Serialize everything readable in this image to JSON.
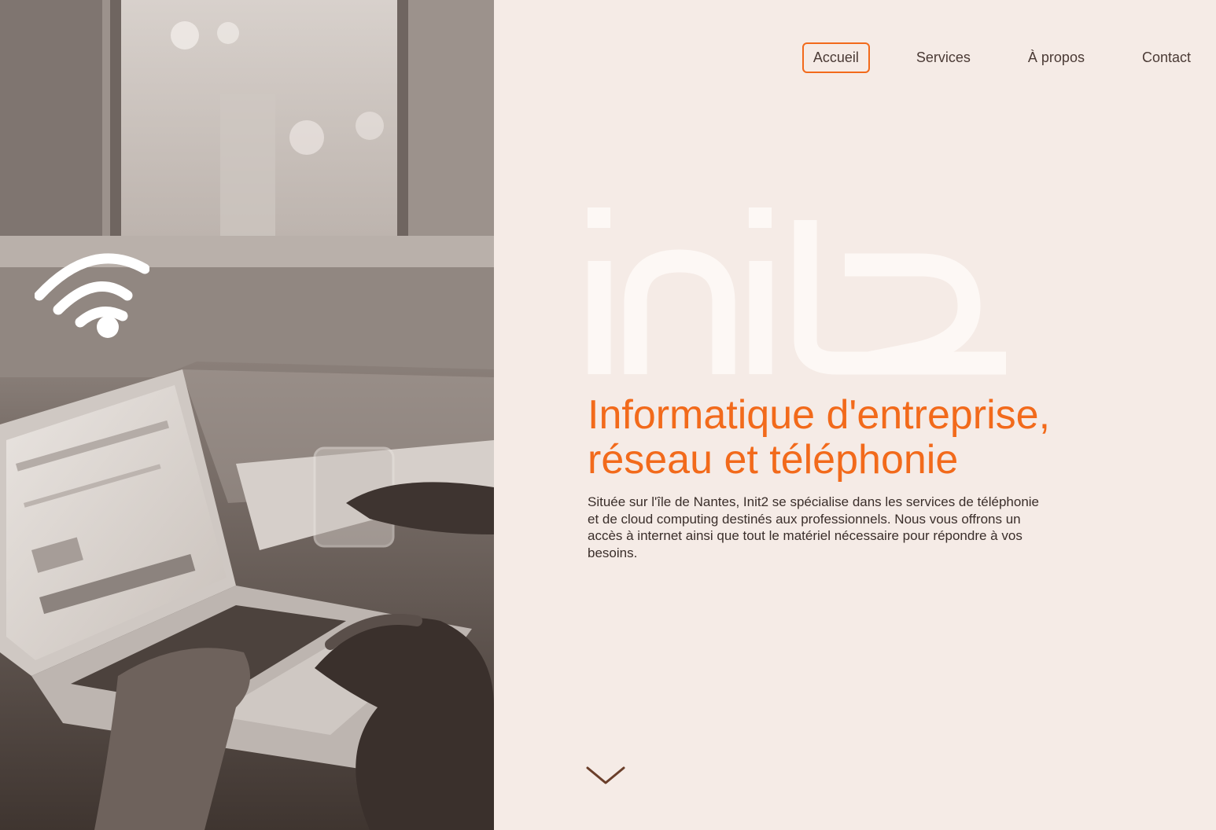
{
  "nav": {
    "items": [
      {
        "label": "Accueil",
        "active": true
      },
      {
        "label": "Services",
        "active": false
      },
      {
        "label": "À propos",
        "active": false
      },
      {
        "label": "Contact",
        "active": false
      }
    ]
  },
  "hero": {
    "logo_text": "init2",
    "headline_line1": "Informatique d'entreprise,",
    "headline_line2": "réseau et téléphonie",
    "description": "Située sur l'île de Nantes, Init2 se spécialise dans les services de téléphonie et de cloud computing destinés aux professionnels. Nous vous offrons un accès à internet ainsi que tout le matériel nécessaire pour répondre à vos besoins."
  },
  "icons": {
    "wifi": "wifi-icon",
    "scroll": "chevron-down-icon"
  },
  "colors": {
    "accent": "#f26a1b",
    "background": "#f5ebe6",
    "logo": "#fdf8f5",
    "text": "#3a2e2a"
  }
}
